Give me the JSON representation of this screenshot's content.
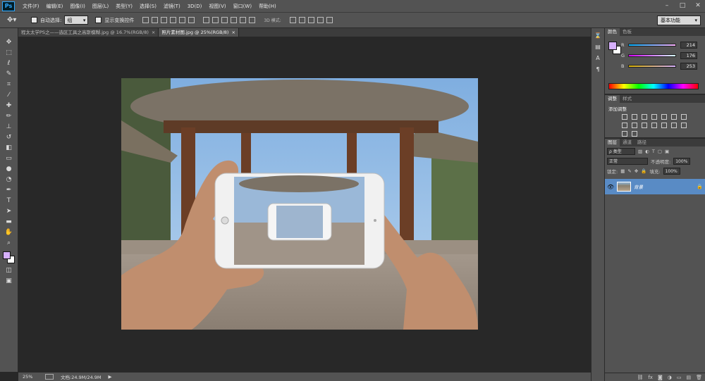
{
  "app": {
    "logo": "Ps"
  },
  "menu": [
    "文件(F)",
    "编辑(E)",
    "图像(I)",
    "图层(L)",
    "类型(Y)",
    "选择(S)",
    "滤镜(T)",
    "3D(D)",
    "视图(V)",
    "窗口(W)",
    "帮助(H)"
  ],
  "options": {
    "auto_select_label": "自动选择:",
    "auto_select_value": "组",
    "show_transform_label": "显示变换控件",
    "mode_3d_label": "3D 模式:",
    "workspace_value": "基本功能"
  },
  "tabs": [
    {
      "label": "程太太学PS之——选区工具之高斯模糊.jpg @ 16.7%(RGB/8)",
      "close": "×"
    },
    {
      "label": "照片素材图.jpg @ 25%(RGB/8)",
      "close": "×"
    }
  ],
  "status": {
    "zoom": "25%",
    "doc_info": "文档:24.9M/24.9M",
    "arrow": "▶"
  },
  "color_panel": {
    "tabs": [
      "颜色",
      "色板"
    ],
    "channels": [
      {
        "label": "R",
        "value": "214"
      },
      {
        "label": "G",
        "value": "176"
      },
      {
        "label": "B",
        "value": "253"
      }
    ]
  },
  "adjust_panel": {
    "tabs": [
      "调整",
      "样式"
    ],
    "title": "添加调整"
  },
  "layers_panel": {
    "tabs": [
      "图层",
      "通道",
      "路径"
    ],
    "filter_label": "ρ 类型",
    "blend_mode": "正常",
    "opacity_label": "不透明度:",
    "opacity_value": "100%",
    "lock_label": "锁定:",
    "fill_label": "填充:",
    "fill_value": "100%",
    "layers": [
      {
        "name": "背景"
      }
    ]
  },
  "colors": {
    "foreground": "#d6b0fd",
    "background": "#ffffff",
    "ui": "#535353",
    "layer_selected": "#598bc5"
  }
}
